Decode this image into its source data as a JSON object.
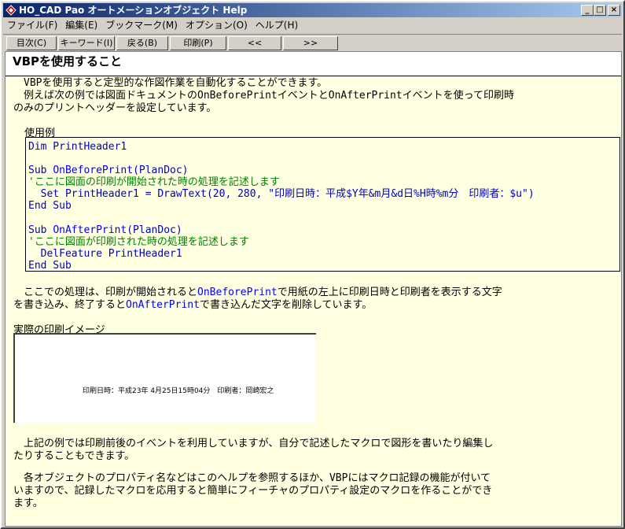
{
  "window": {
    "title": "HO_CAD Pao オートメーションオブジェクト Help"
  },
  "menu": [
    "ファイル(F)",
    "編集(E)",
    "ブックマーク(M)",
    "オプション(O)",
    "ヘルプ(H)"
  ],
  "toolbar": [
    "目次(C)",
    "キーワード(I)",
    "戻る(B)",
    "印刷(P)",
    "<<",
    ">>"
  ],
  "page": {
    "title": "VBPを使用すること",
    "intro1": "　VBPを使用すると定型的な作図作業を自動化することができます。",
    "intro2": "　例えば次の例では図面ドキュメントのOnBeforePrintイベントとOnAfterPrintイベントを使って印刷時",
    "intro3": "のみのプリントヘッダーを設定しています。",
    "example_label": "使用例",
    "code": {
      "l1_a": "Dim PrintHeader1",
      "l3_kw": "Sub ",
      "l3_ev": "OnBeforePrint",
      "l3_rest": "(PlanDoc)",
      "l4": "'ここに図面の印刷が開始された時の処理を記述します",
      "l5_a": "  Set PrintHeader1 = DrawText(20, 280, ",
      "l5_str": "\"印刷日時：平成$Y年&m月&d日%H時%m分　印刷者：$u\"",
      "l5_end": ")",
      "l6": "End Sub",
      "l8_kw": "Sub ",
      "l8_ev": "OnAfterPrint",
      "l8_rest": "(PlanDoc)",
      "l9": "'ここに図面が印刷された時の処理を記述します",
      "l10": "  DelFeature PrintHeader1",
      "l11": "End Sub"
    },
    "desc1_a": "　ここでの処理は、印刷が開始されると",
    "desc1_ev": "OnBeforePrint",
    "desc1_b": "で用紙の左上に印刷日時と印刷者を表示する文字",
    "desc2_a": "を書き込み、終了すると",
    "desc2_ev": "OnAfterPrint",
    "desc2_b": "で書き込んだ文字を削除しています。",
    "print_label": "実際の印刷イメージ",
    "print_text": "印刷日時：平成23年 4月25日15時04分　印刷者：岡崎宏之",
    "p3_1": "　上記の例では印刷前後のイベントを利用していますが、自分で記述したマクロで図形を書いたり編集し",
    "p3_2": "たりすることもできます。",
    "p4_1": "　各オブジェクトのプロパティ名などはこのヘルプを参照するほか、VBPにはマクロ記録の機能が付いて",
    "p4_2": "いますので、記録したマクロを応用すると簡単にフィーチャのプロパティ設定のマクロを作ることができ",
    "p4_3": "ます。"
  }
}
